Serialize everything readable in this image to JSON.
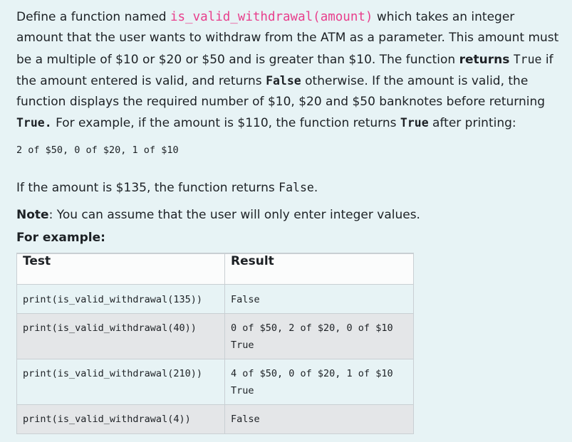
{
  "intro": {
    "t1": "Define a function named ",
    "fn": "is_valid_withdrawal(amount)",
    "t2": " which takes an integer amount that the user wants to withdraw from the ATM as a parameter.  This amount must be a multiple of $10 or $20 or $50 and is greater than $10.  The function ",
    "returns": "returns",
    "t3": " ",
    "true1": "True",
    "t4": " if the amount entered is valid, and returns ",
    "false1": "False",
    "t5": "  otherwise.  If the amount is valid, the function displays the required number of $10, $20 and $50 banknotes before returning ",
    "true2": "True.",
    "t6": "  For example, if the amount is $110, the function returns ",
    "true3": "True",
    "t7": " after printing:"
  },
  "example_output": "2 of $50, 0 of $20, 1 of $10",
  "para2": {
    "t1": "If the amount is $135, the function returns ",
    "false": "False",
    "t2": "."
  },
  "note": {
    "label": "Note",
    "text": ":  You can assume that the user will only enter integer values."
  },
  "for_example": "For example:",
  "table": {
    "headers": [
      "Test",
      "Result"
    ],
    "rows": [
      {
        "test": "print(is_valid_withdrawal(135))",
        "result": [
          "False"
        ]
      },
      {
        "test": "print(is_valid_withdrawal(40))",
        "result": [
          "0 of $50, 2 of $20, 0 of $10",
          "True"
        ]
      },
      {
        "test": "print(is_valid_withdrawal(210))",
        "result": [
          "4 of $50, 0 of $20, 1 of $10",
          "True"
        ]
      },
      {
        "test": "print(is_valid_withdrawal(4))",
        "result": [
          "False"
        ]
      }
    ]
  }
}
